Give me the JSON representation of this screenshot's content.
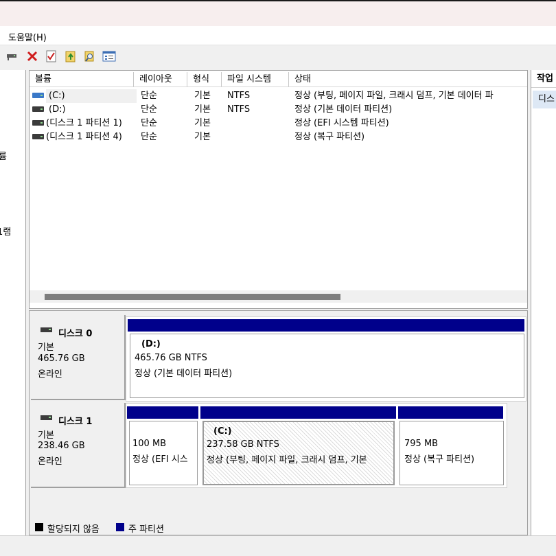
{
  "menubar": {
    "help": "도움말(H)"
  },
  "toolbar": {
    "icons": [
      "connect-icon",
      "delete-icon",
      "check-icon",
      "up-folder-icon",
      "search-icon",
      "properties-icon"
    ]
  },
  "left_pane": {
    "fragments": [
      "륨",
      "1램"
    ]
  },
  "volume_list": {
    "columns": [
      "볼륨",
      "레이아웃",
      "형식",
      "파일 시스템",
      "상태"
    ],
    "rows": [
      {
        "volume": "(C:)",
        "layout": "단순",
        "type": "기본",
        "fs": "NTFS",
        "status": "정상 (부팅, 페이지 파일, 크래시 덤프, 기본 데이터 파"
      },
      {
        "volume": "(D:)",
        "layout": "단순",
        "type": "기본",
        "fs": "NTFS",
        "status": "정상 (기본 데이터 파티션)"
      },
      {
        "volume": "(디스크 1 파티션 1)",
        "layout": "단순",
        "type": "기본",
        "fs": "",
        "status": "정상 (EFI 시스템 파티션)"
      },
      {
        "volume": "(디스크 1 파티션 4)",
        "layout": "단순",
        "type": "기본",
        "fs": "",
        "status": "정상 (복구 파티션)"
      }
    ]
  },
  "disks": [
    {
      "name": "디스크 0",
      "kind": "기본",
      "size": "465.76 GB",
      "state": "온라인",
      "partitions": [
        {
          "label": "(D:)",
          "size": "465.76 GB NTFS",
          "status": "정상 (기본 데이터 파티션)"
        }
      ]
    },
    {
      "name": "디스크 1",
      "kind": "기본",
      "size": "238.46 GB",
      "state": "온라인",
      "partitions": [
        {
          "label": "",
          "size": "100 MB",
          "status": "정상 (EFI 시스"
        },
        {
          "label": "(C:)",
          "size": "237.58 GB NTFS",
          "status": "정상 (부팅, 페이지 파일, 크래시 덤프, 기본"
        },
        {
          "label": "",
          "size": "795 MB",
          "status": "정상 (복구 파티션)"
        }
      ]
    }
  ],
  "legend": {
    "unallocated": "할당되지 않음",
    "primary": "주 파티션",
    "unallocated_color": "#000000",
    "primary_color": "#00008b"
  },
  "actions_pane": {
    "header": "작업",
    "item": "디스"
  }
}
